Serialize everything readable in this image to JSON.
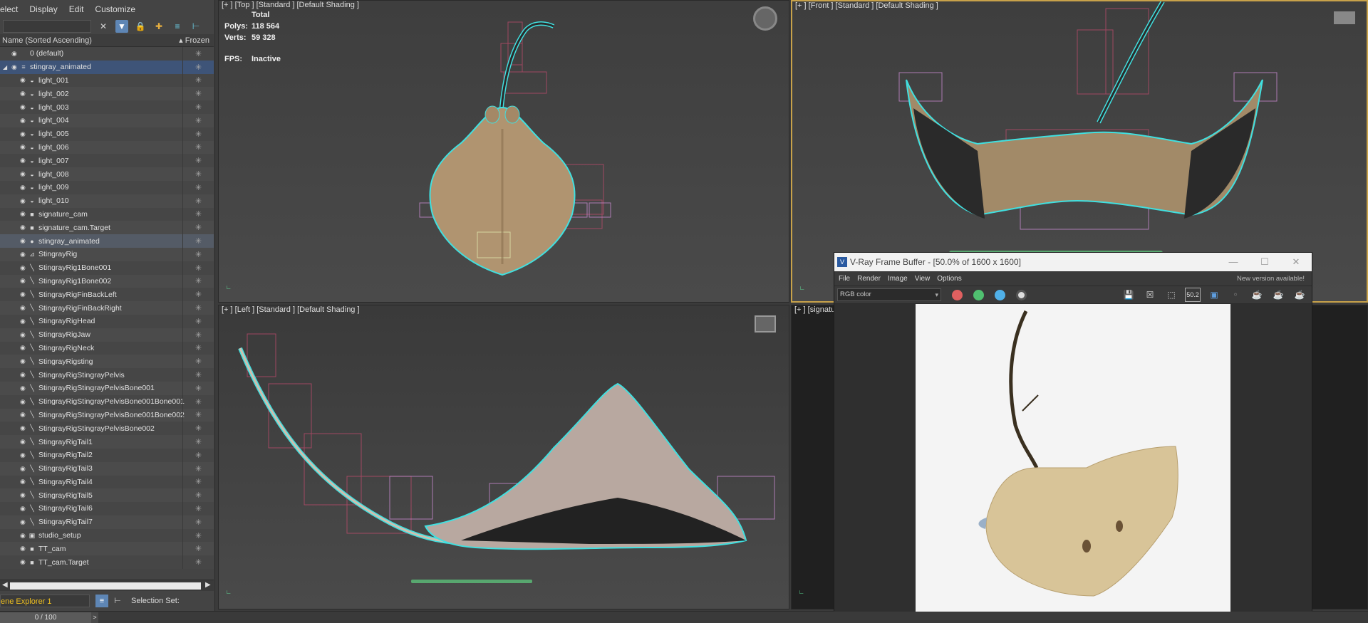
{
  "menu": {
    "items": [
      "elect",
      "Display",
      "Edit",
      "Customize"
    ]
  },
  "explorer": {
    "column_name": "Name (Sorted Ascending)",
    "column_frozen": "▴ Frozen",
    "rows": [
      {
        "name": "0 (default)",
        "icon": "layer-icon",
        "state": "normal",
        "indent": 0
      },
      {
        "name": "stingray_animated",
        "icon": "layer-stack-icon",
        "state": "group",
        "indent": 0
      },
      {
        "name": "light_001",
        "icon": "bulb-icon",
        "state": "normal",
        "indent": 1
      },
      {
        "name": "light_002",
        "icon": "bulb-icon",
        "state": "normal",
        "indent": 1
      },
      {
        "name": "light_003",
        "icon": "bulb-icon",
        "state": "normal",
        "indent": 1
      },
      {
        "name": "light_004",
        "icon": "bulb-icon",
        "state": "normal",
        "indent": 1
      },
      {
        "name": "light_005",
        "icon": "bulb-icon",
        "state": "normal",
        "indent": 1
      },
      {
        "name": "light_006",
        "icon": "bulb-icon",
        "state": "normal",
        "indent": 1
      },
      {
        "name": "light_007",
        "icon": "bulb-icon",
        "state": "normal",
        "indent": 1
      },
      {
        "name": "light_008",
        "icon": "bulb-icon",
        "state": "normal",
        "indent": 1
      },
      {
        "name": "light_009",
        "icon": "bulb-icon",
        "state": "normal",
        "indent": 1
      },
      {
        "name": "light_010",
        "icon": "bulb-icon",
        "state": "normal",
        "indent": 1
      },
      {
        "name": "signature_cam",
        "icon": "camera-icon",
        "state": "normal",
        "indent": 1
      },
      {
        "name": "signature_cam.Target",
        "icon": "camera-icon",
        "state": "normal",
        "indent": 1
      },
      {
        "name": "stingray_animated",
        "icon": "sphere-icon",
        "state": "selected",
        "indent": 1
      },
      {
        "name": "StingrayRig",
        "icon": "rig-icon",
        "state": "normal",
        "indent": 1
      },
      {
        "name": "StingrayRig1Bone001",
        "icon": "bone-icon",
        "state": "normal",
        "indent": 1
      },
      {
        "name": "StingrayRig1Bone002",
        "icon": "bone-icon",
        "state": "normal",
        "indent": 1
      },
      {
        "name": "StingrayRigFinBackLeft",
        "icon": "bone-icon",
        "state": "normal",
        "indent": 1
      },
      {
        "name": "StingrayRigFinBackRight",
        "icon": "bone-icon",
        "state": "normal",
        "indent": 1
      },
      {
        "name": "StingrayRigHead",
        "icon": "bone-icon",
        "state": "normal",
        "indent": 1
      },
      {
        "name": "StingrayRigJaw",
        "icon": "bone-icon",
        "state": "normal",
        "indent": 1
      },
      {
        "name": "StingrayRigNeck",
        "icon": "bone-icon",
        "state": "normal",
        "indent": 1
      },
      {
        "name": "StingrayRigsting",
        "icon": "bone-icon",
        "state": "normal",
        "indent": 1
      },
      {
        "name": "StingrayRigStingrayPelvis",
        "icon": "bone-icon",
        "state": "normal",
        "indent": 1
      },
      {
        "name": "StingrayRigStingrayPelvisBone001",
        "icon": "bone-icon",
        "state": "normal",
        "indent": 1
      },
      {
        "name": "StingrayRigStingrayPelvisBone001Bone001",
        "icon": "bone-icon",
        "state": "normal",
        "indent": 1
      },
      {
        "name": "StingrayRigStingrayPelvisBone001Bone002",
        "icon": "bone-icon",
        "state": "normal",
        "indent": 1
      },
      {
        "name": "StingrayRigStingrayPelvisBone002",
        "icon": "bone-icon",
        "state": "normal",
        "indent": 1
      },
      {
        "name": "StingrayRigTail1",
        "icon": "bone-icon",
        "state": "normal",
        "indent": 1
      },
      {
        "name": "StingrayRigTail2",
        "icon": "bone-icon",
        "state": "normal",
        "indent": 1
      },
      {
        "name": "StingrayRigTail3",
        "icon": "bone-icon",
        "state": "normal",
        "indent": 1
      },
      {
        "name": "StingrayRigTail4",
        "icon": "bone-icon",
        "state": "normal",
        "indent": 1
      },
      {
        "name": "StingrayRigTail5",
        "icon": "bone-icon",
        "state": "normal",
        "indent": 1
      },
      {
        "name": "StingrayRigTail6",
        "icon": "bone-icon",
        "state": "normal",
        "indent": 1
      },
      {
        "name": "StingrayRigTail7",
        "icon": "bone-icon",
        "state": "normal",
        "indent": 1
      },
      {
        "name": "studio_setup",
        "icon": "scene-icon",
        "state": "normal",
        "indent": 1
      },
      {
        "name": "TT_cam",
        "icon": "camera-icon",
        "state": "normal",
        "indent": 1
      },
      {
        "name": "TT_cam.Target",
        "icon": "camera-icon",
        "state": "normal",
        "indent": 1
      }
    ],
    "footer_name": "ene Explorer 1",
    "selection_set_label": "Selection Set:"
  },
  "viewports": {
    "top": {
      "label": "[+ ] [Top ]  [Standard ]  [Default Shading ]"
    },
    "front": {
      "label": "[+ ] [Front ]  [Standard ]  [Default Shading ]"
    },
    "left": {
      "label": "[+ ] [Left ]  [Standard ]  [Default Shading ]"
    },
    "cam": {
      "label": "[+ ] [signatu"
    }
  },
  "stats": {
    "total_label": "Total",
    "polys_label": "Polys:",
    "polys_value": "118 564",
    "verts_label": "Verts:",
    "verts_value": "59 328",
    "fps_label": "FPS:",
    "fps_value": "Inactive"
  },
  "vfb": {
    "title": "V-Ray Frame Buffer - [50.0% of 1600 x 1600]",
    "menu": [
      "File",
      "Render",
      "Image",
      "View",
      "Options"
    ],
    "new_version": "New version available!",
    "channel": "RGB color",
    "zoom_tool": "50.2"
  },
  "timeslider": {
    "value": "0 / 100"
  },
  "colors": {
    "accent_blue": "#5e86b5",
    "active_viewport_border": "#c8a24a",
    "selection_outline": "#40e0e0",
    "footer_name": "#f0c020"
  }
}
